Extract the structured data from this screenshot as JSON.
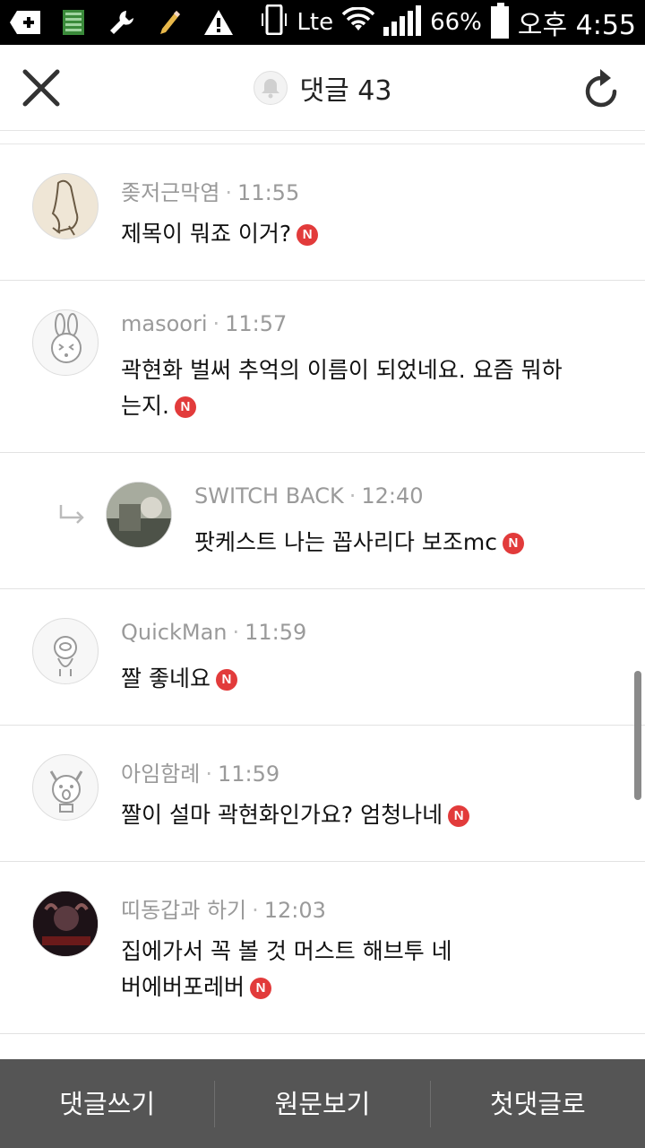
{
  "status_bar": {
    "lte_label": "Ltе",
    "battery_percent": "66%",
    "time": "오후 4:55"
  },
  "header": {
    "title": "댓글 43"
  },
  "comments": [
    {
      "author": "좆저근막염",
      "time": "11:55",
      "text": "제목이 뭐죠 이거?",
      "new_badge": "N",
      "is_reply": false
    },
    {
      "author": "masoori",
      "time": "11:57",
      "text": "곽현화 벌써 추억의 이름이 되었네요. 요즘 뭐하는지.",
      "new_badge": "N",
      "is_reply": false
    },
    {
      "author": "SWITCH BACK",
      "time": "12:40",
      "text": "팟케스트 나는 꼽사리다 보조mc",
      "new_badge": "N",
      "is_reply": true
    },
    {
      "author": "QuickMan",
      "time": "11:59",
      "text": "짤 좋네요",
      "new_badge": "N",
      "is_reply": false
    },
    {
      "author": "아임함례",
      "time": "11:59",
      "text": "짤이 설마 곽현화인가요? 엄청나네",
      "new_badge": "N",
      "is_reply": false
    },
    {
      "author": "띠동갑과 하기",
      "time": "12:03",
      "text": "집에가서 꼭 볼 것 머스트 해브투 네버에버포레버",
      "new_badge": "N",
      "is_reply": false
    }
  ],
  "bottom_bar": {
    "write_comment": "댓글쓰기",
    "view_original": "원문보기",
    "first_comment": "첫댓글로"
  },
  "colors": {
    "badge": "#e23b3b",
    "bottom_bar": "#555555",
    "meta_text": "#9a9a9a"
  }
}
